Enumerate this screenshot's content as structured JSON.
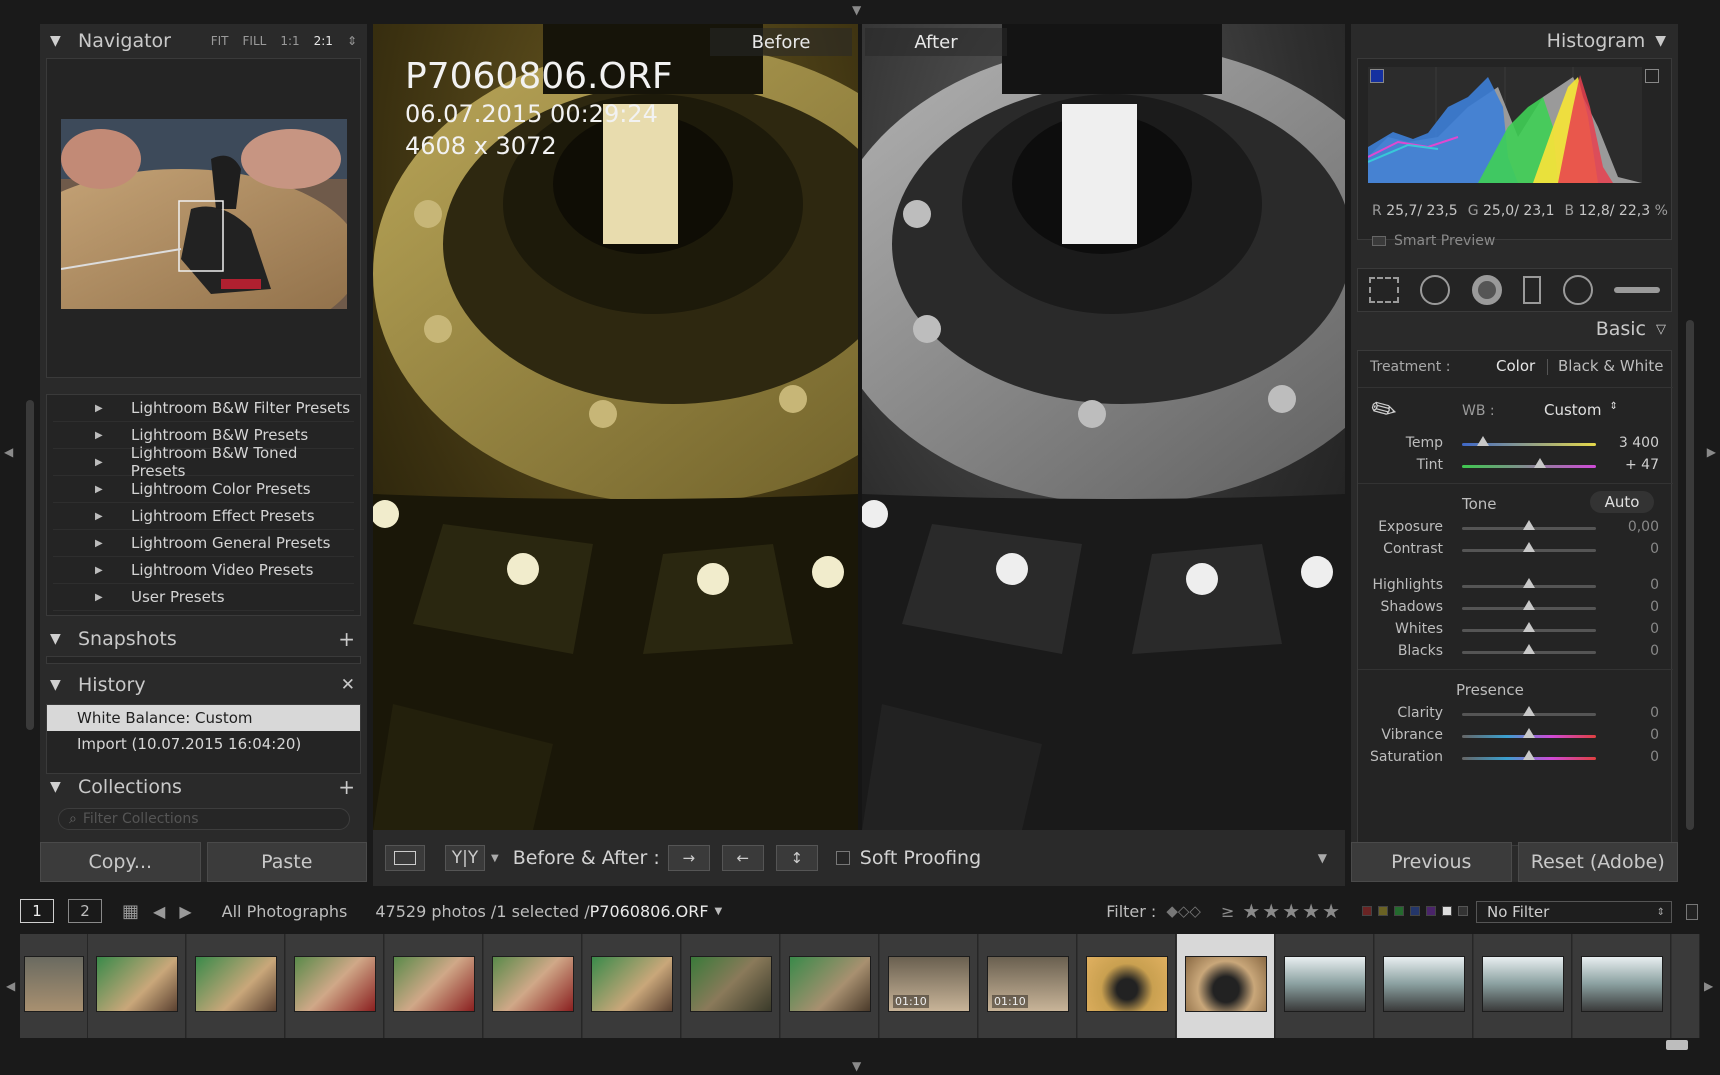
{
  "navigator": {
    "title": "Navigator",
    "modes": [
      "FIT",
      "FILL",
      "1:1",
      "2:1"
    ]
  },
  "presets": {
    "items": [
      "Lightroom B&W Filter Presets",
      "Lightroom B&W Presets",
      "Lightroom B&W Toned Presets",
      "Lightroom Color Presets",
      "Lightroom Effect Presets",
      "Lightroom General Presets",
      "Lightroom Video Presets",
      "User Presets"
    ]
  },
  "snapshots": {
    "title": "Snapshots"
  },
  "history": {
    "title": "History",
    "items": [
      "White Balance: Custom",
      "Import (10.07.2015 16:04:20)"
    ]
  },
  "collections": {
    "title": "Collections",
    "filter_placeholder": "Filter Collections"
  },
  "left_buttons": {
    "copy": "Copy...",
    "paste": "Paste"
  },
  "view": {
    "before_label": "Before",
    "after_label": "After",
    "filename": "P7060806.ORF",
    "datetime": "06.07.2015 00:29:24",
    "dimensions": "4608 x 3072"
  },
  "toolbar": {
    "ba_label": "Before & After :",
    "soft_proofing": "Soft Proofing"
  },
  "histogram": {
    "title": "Histogram",
    "r_label": "R",
    "r_val": "25,7/ 23,5",
    "g_label": "G",
    "g_val": "25,0/ 23,1",
    "b_label": "B",
    "b_val": "12,8/ 22,3",
    "pct": "%",
    "smart_preview": "Smart Preview"
  },
  "basic": {
    "title": "Basic",
    "treatment_label": "Treatment :",
    "treatment_color": "Color",
    "treatment_bw": "Black & White",
    "wb_label": "WB :",
    "wb_value": "Custom",
    "tone_label": "Tone",
    "auto_label": "Auto",
    "presence_label": "Presence",
    "sliders": {
      "temp": {
        "label": "Temp",
        "value": "3 400",
        "pos": 0.16
      },
      "tint": {
        "label": "Tint",
        "value": "+ 47",
        "pos": 0.58
      },
      "exposure": {
        "label": "Exposure",
        "value": "0,00",
        "pos": 0.5
      },
      "contrast": {
        "label": "Contrast",
        "value": "0",
        "pos": 0.5
      },
      "highlights": {
        "label": "Highlights",
        "value": "0",
        "pos": 0.5
      },
      "shadows": {
        "label": "Shadows",
        "value": "0",
        "pos": 0.5
      },
      "whites": {
        "label": "Whites",
        "value": "0",
        "pos": 0.5
      },
      "blacks": {
        "label": "Blacks",
        "value": "0",
        "pos": 0.5
      },
      "clarity": {
        "label": "Clarity",
        "value": "0",
        "pos": 0.5
      },
      "vibrance": {
        "label": "Vibrance",
        "value": "0",
        "pos": 0.5
      },
      "saturation": {
        "label": "Saturation",
        "value": "0",
        "pos": 0.5
      }
    }
  },
  "right_buttons": {
    "previous": "Previous",
    "reset": "Reset (Adobe)"
  },
  "filmbar": {
    "view1": "1",
    "view2": "2",
    "source": "All Photographs",
    "count_text": "47529 photos /1 selected /",
    "current_file": "P7060806.ORF",
    "filter_label": "Filter :",
    "gte": "≥",
    "no_filter": "No Filter"
  },
  "filmstrip": {
    "durations": [
      "01:10",
      "01:10"
    ]
  }
}
